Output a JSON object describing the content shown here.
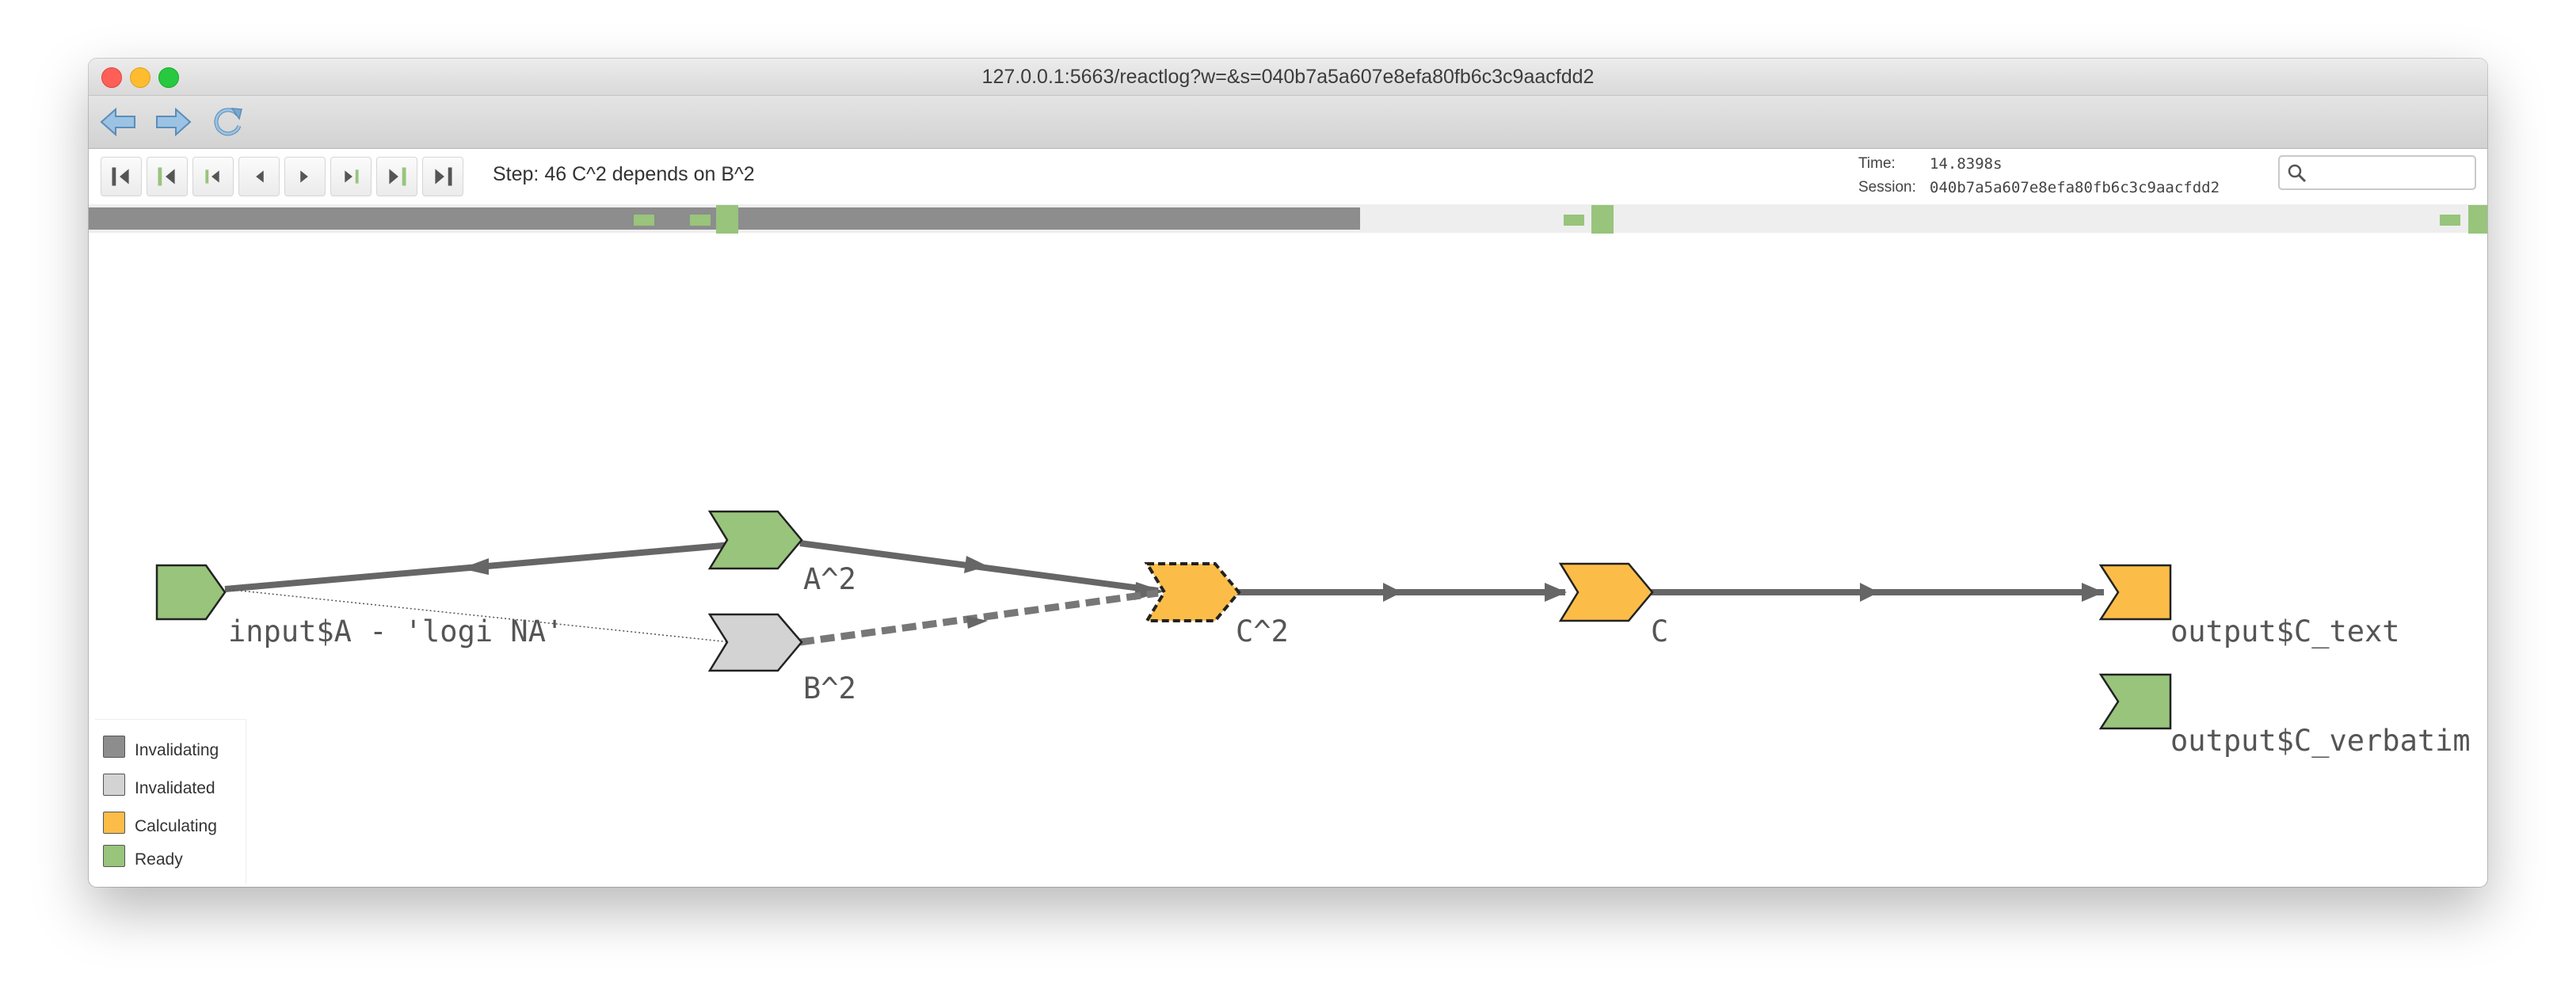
{
  "window": {
    "title": "127.0.0.1:5663/reactlog?w=&s=040b7a5a607e8efa80fb6c3c9aacfdd2"
  },
  "toolbar": {
    "buttons": [
      {
        "name": "back",
        "icon": "arrow-left-icon"
      },
      {
        "name": "forward",
        "icon": "arrow-right-icon"
      },
      {
        "name": "refresh",
        "icon": "refresh-icon"
      }
    ]
  },
  "controls": {
    "step_text": "Step: 46  C^2 depends on B^2",
    "time_label": "Time:",
    "time_value": "14.8398s",
    "session_label": "Session:",
    "session_value": "040b7a5a607e8efa80fb6c3c9aacfdd2",
    "search_value": "",
    "step_buttons": [
      {
        "name": "first-step",
        "icon": "skip-to-start-icon"
      },
      {
        "name": "prev-idle",
        "icon": "prev-idle-icon"
      },
      {
        "name": "prev-cycle",
        "icon": "prev-cycle-icon"
      },
      {
        "name": "prev-step",
        "icon": "step-back-icon"
      },
      {
        "name": "next-step",
        "icon": "step-forward-icon"
      },
      {
        "name": "next-cycle",
        "icon": "next-cycle-icon"
      },
      {
        "name": "next-idle",
        "icon": "next-idle-icon"
      },
      {
        "name": "last-step",
        "icon": "skip-to-end-icon"
      }
    ]
  },
  "timeline": {
    "progress_fraction": 0.53
  },
  "graph": {
    "nodes": [
      {
        "id": "inputA",
        "label": "input$A - 'logi NA'",
        "state": "ready"
      },
      {
        "id": "A2",
        "label": "A^2",
        "state": "ready"
      },
      {
        "id": "B2",
        "label": "B^2",
        "state": "invalidated"
      },
      {
        "id": "C2",
        "label": "C^2",
        "state": "calculating",
        "active": true
      },
      {
        "id": "C",
        "label": "C",
        "state": "calculating"
      },
      {
        "id": "out_text",
        "label": "output$C_text",
        "state": "calculating"
      },
      {
        "id": "out_verbatim",
        "label": "output$C_verbatim",
        "state": "ready"
      }
    ]
  },
  "legend": {
    "items": [
      {
        "label": "Invalidating",
        "color": "#8d8d8d"
      },
      {
        "label": "Invalidated",
        "color": "#d3d3d3"
      },
      {
        "label": "Calculating",
        "color": "#fcbd48"
      },
      {
        "label": "Ready",
        "color": "#98c47c"
      }
    ]
  },
  "colors": {
    "ready": "#98c47c",
    "invalidated": "#d3d3d3",
    "calculating": "#fcbd48",
    "invalidating": "#8d8d8d",
    "edge": "#666666"
  }
}
